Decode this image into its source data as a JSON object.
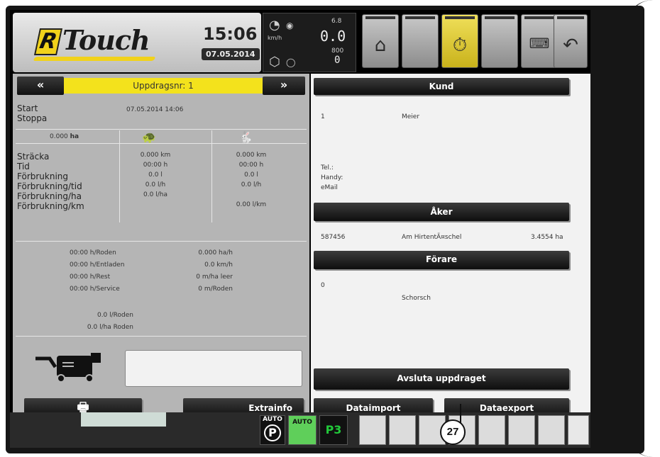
{
  "header": {
    "logo_letter": "R",
    "logo_text": "Touch",
    "time": "15:06",
    "date": "07.05.2014",
    "speed_value": "0.0",
    "speed_unit": "km/h",
    "speed_top": "6.8",
    "rpm": "800",
    "rpm_bottom": "0"
  },
  "order": {
    "prev_label": "«",
    "next_label": "»",
    "title": "Uppdragsnr: 1"
  },
  "left": {
    "start_label": "Start",
    "start_value": "07.05.2014  14:06",
    "stop_label": "Stoppa",
    "area": "0.000",
    "area_unit": "ha",
    "rows": [
      {
        "label": "Sträcka",
        "slow": "0.000 km",
        "fast": "0.000 km"
      },
      {
        "label": "Tid",
        "slow": "00:00 h",
        "fast": "00:00 h"
      },
      {
        "label": "Förbrukning",
        "slow": "0.0 l",
        "fast": "0.0 l"
      },
      {
        "label": "Förbrukning/tid",
        "slow": "0.0 l/h",
        "fast": "0.0 l/h"
      },
      {
        "label": "Förbrukning/ha",
        "slow": "0.0 l/ha",
        "fast": ""
      },
      {
        "label": "Förbrukning/km",
        "slow": "",
        "fast": "0.00 l/km"
      }
    ],
    "stats_left": [
      "00:00 h/Roden",
      "00:00 h/Entladen",
      "00:00 h/Rest",
      "00:00 h/Service"
    ],
    "stats_right": [
      "0.000 ha/h",
      "0.0 km/h",
      "0 m/ha leer",
      "0 m/Roden"
    ],
    "stats_bottom": [
      "0.0 l/Roden",
      "0.0 l/ha Roden"
    ],
    "print_label": "",
    "extrainfo_label": "Extrainfo"
  },
  "right": {
    "kund_header": "Kund",
    "kund_nr": "1",
    "kund_name": "Meier",
    "tel": "Tel.:",
    "handy": "Handy:",
    "email": "eMail",
    "aker_header": "Åker",
    "aker_nr": "587456",
    "aker_name": "Am HirtentÃ¤schel",
    "aker_area": "3.4554  ha",
    "forare_header": "Förare",
    "forare_nr": "0",
    "forare_name": "Schorsch",
    "finish_label": "Avsluta uppdraget",
    "import_label": "Dataimport",
    "export_label": "Dataexport"
  },
  "bottom": {
    "auto_label": "AUTO",
    "p_label": "P",
    "p3_label": "P3"
  },
  "callout": "27",
  "colors": {
    "yellow": "#f3e21c",
    "panel_grey": "#b5b5b5",
    "panel_light": "#f2f2f2",
    "p3_green": "#22c83a"
  }
}
